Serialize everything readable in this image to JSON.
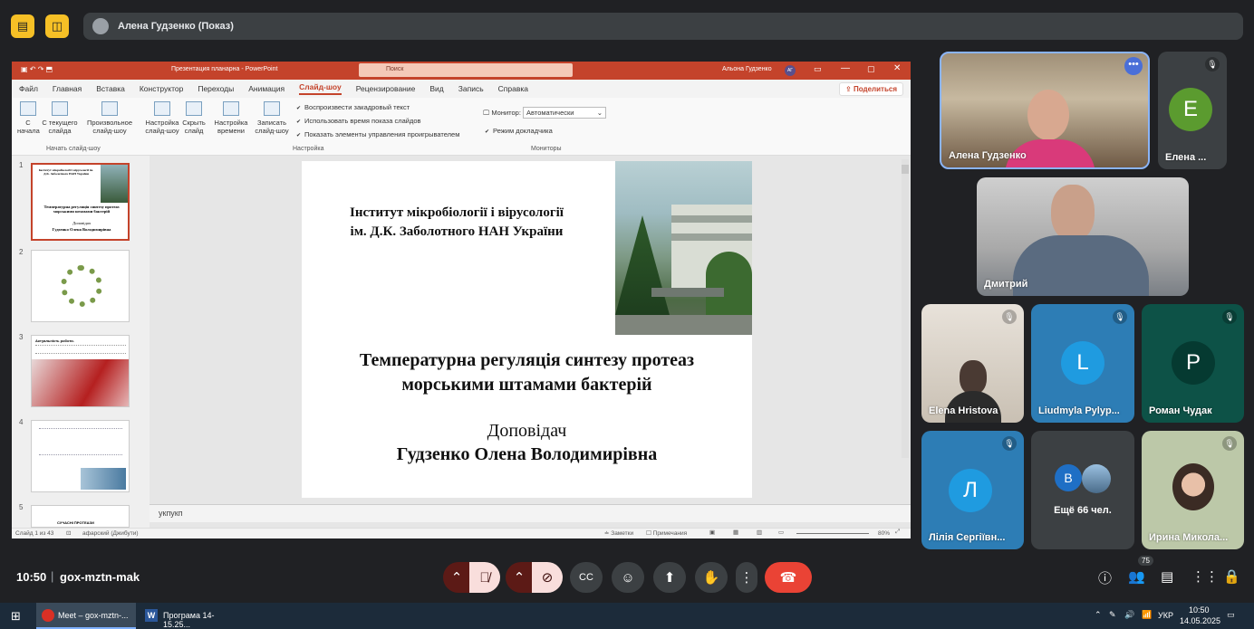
{
  "meet": {
    "presenter_chip": "Алена Гудзенко (Показ)",
    "time": "10:50",
    "meeting_code": "gox-mztn-mak",
    "participants_badge": "75",
    "more_count": "Ещё 66 чел."
  },
  "ppt": {
    "title": "Презентация планарна - PowerPoint",
    "search_placeholder": "Поиск",
    "user_name": "Альона Гудзенко",
    "user_initials": "АГ",
    "menu": [
      "Файл",
      "Главная",
      "Вставка",
      "Конструктор",
      "Переходы",
      "Анимация",
      "Слайд-шоу",
      "Рецензирование",
      "Вид",
      "Запись",
      "Справка"
    ],
    "active_menu": "Слайд-шоу",
    "share": "Поделиться",
    "ribbon": {
      "btn_from_start": "С начала",
      "btn_from_current": "С текущего слайда",
      "btn_custom": "Произвольное слайд-шоу",
      "group_start": "Начать слайд-шоу",
      "btn_setup": "Настройка слайд-шоу",
      "btn_hide": "Скрыть слайд",
      "btn_timing": "Настройка времени",
      "btn_record": "Записать слайд-шоу",
      "chk_narration": "Воспроизвести закадровый текст",
      "chk_timings": "Использовать время показа слайдов",
      "chk_controls": "Показать элементы управления проигрывателем",
      "group_setup": "Настройка",
      "monitor_label": "Монитор:",
      "monitor_value": "Автоматически",
      "chk_presenter": "Режим докладчика",
      "group_monitors": "Мониторы"
    },
    "thumbs": [
      {
        "num": "1",
        "t1": "Інститут мікробіології і вірусології ім. Д.К. Заболотного НАН України",
        "t2": "Температурна регуляція синтезу протеаз морськими штамами бактерій",
        "t3": "Доповідач",
        "t4": "Гудзенко Олена Володимирівна"
      },
      {
        "num": "2"
      },
      {
        "num": "3",
        "t1": "Актуальність роботи."
      },
      {
        "num": "4"
      },
      {
        "num": "5",
        "t1": "СУЧАСНІ ПРОТЕАЗИ"
      }
    ],
    "slide": {
      "inst1": "Інститут мікробіології і вірусології",
      "inst2": "ім. Д.К. Заболотного НАН України",
      "title1": "Температурна регуляція синтезу протеаз",
      "title2": "морськими штамами бактерій",
      "reporter": "Доповідач",
      "name": "Гудзенко Олена Володимирівна"
    },
    "notes_text": "укпукп",
    "status": {
      "slide_counter": "Слайд 1 из 43",
      "language": "афарский (Джибути)",
      "notes_btn": "Заметки",
      "comments_btn": "Примечания",
      "zoom": "80%"
    }
  },
  "participants": [
    {
      "name": "Алена Гудзенко"
    },
    {
      "name": "Елена ...",
      "initial": "E"
    },
    {
      "name": "Дмитрий"
    },
    {
      "name": "Elena Hristova"
    },
    {
      "name": "Liudmyla Pylyp...",
      "initial": "L"
    },
    {
      "name": "Роман Чудак",
      "initial": "P"
    },
    {
      "name": "Лілія Сергіївн...",
      "initial": "Л"
    },
    {
      "name": "Ирина Микола..."
    },
    {
      "more_initial": "B"
    }
  ],
  "taskbar": {
    "item1": "Meet – gox-mztn-...",
    "item2": "Програма 14-15.25...",
    "lang": "УКР",
    "time": "10:50",
    "date": "14.05.2025"
  },
  "colors": {
    "ppt_accent": "#c4432b",
    "end_call": "#ea4335",
    "meet_bg": "#202124"
  }
}
